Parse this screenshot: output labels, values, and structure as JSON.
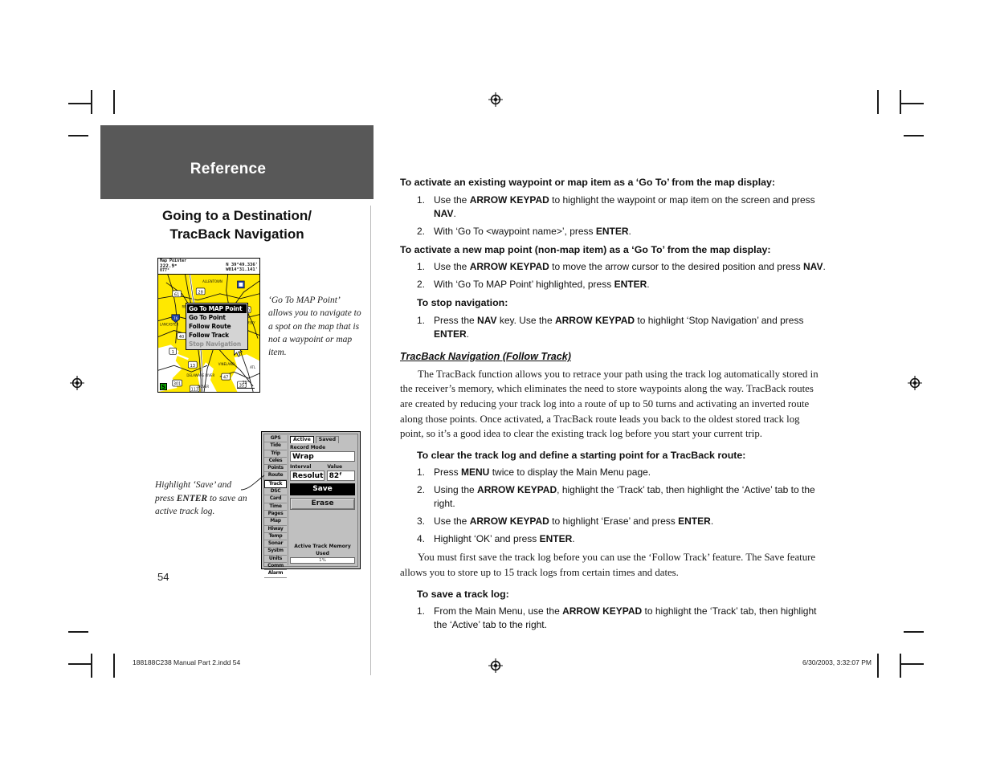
{
  "header": {
    "band_label": "Reference",
    "chapter_title_line1": "Going to a Destination/",
    "chapter_title_line2": "TracBack Navigation"
  },
  "page_number": "54",
  "figures": {
    "map_screen": {
      "header": {
        "title": "Map Pointer",
        "distance": "222.9ᵐ",
        "bearing": "077°",
        "lat": "N 39°49.336'",
        "lon": "W014°31.141'"
      },
      "menu_items": [
        {
          "label": "Go To MAP Point",
          "state": "selected"
        },
        {
          "label": "Go To Point",
          "state": "normal"
        },
        {
          "label": "Follow Route",
          "state": "normal"
        },
        {
          "label": "Follow Track",
          "state": "normal"
        },
        {
          "label": "Stop Navigation",
          "state": "disabled"
        }
      ],
      "scale": "12ᵐ",
      "satellite_indicator": "S",
      "caption": "‘Go To MAP Point’ allows you to navigate to a spot on the map that is not a waypoint or map item."
    },
    "track_screen": {
      "tabs": [
        "GPS",
        "Tide",
        "Trip",
        "Celes",
        "Points",
        "Route",
        "Track",
        "DSC",
        "Card",
        "Time",
        "Pages",
        "Map",
        "Hiway",
        "Temp",
        "Sonar",
        "Systm",
        "Units",
        "Comm",
        "Alarm"
      ],
      "active_tab": "Track",
      "subtabs": [
        "Active",
        "Saved"
      ],
      "active_subtab": "Active",
      "record_mode_label": "Record Mode",
      "record_mode_value": "Wrap",
      "interval_label": "Interval",
      "interval_value": "Resolution",
      "value_label": "Value",
      "value_value": "82ᶠ",
      "save_button": "Save",
      "erase_button": "Erase",
      "memory_label": "Active Track Memory Used",
      "memory_value": "1%",
      "caption_part1": "Highlight ‘Save’ and press ",
      "caption_bold": "ENTER",
      "caption_part2": " to save an active track log."
    }
  },
  "content": {
    "section1": {
      "heading": "To activate an existing waypoint or map item as a ‘Go To’ from the map display:",
      "steps": [
        {
          "num": "1.",
          "html": "Use the <b>ARROW KEYPAD</b> to highlight the waypoint or map item on the screen and press <b>NAV</b>."
        },
        {
          "num": "2.",
          "html": "With ‘Go To &lt;waypoint name&gt;’, press <b>ENTER</b>."
        }
      ]
    },
    "section2": {
      "heading": "To activate a new map point (non-map item) as a ‘Go To’ from the map display:",
      "steps": [
        {
          "num": "1.",
          "html": "Use the <b>ARROW KEYPAD</b> to move the arrow cursor to the desired position and press <b>NAV</b>."
        },
        {
          "num": "2.",
          "html": "With ‘Go To MAP Point’ highlighted, press <b>ENTER</b>."
        }
      ]
    },
    "section3": {
      "heading": "To stop navigation:",
      "steps": [
        {
          "num": "1.",
          "html": "Press the <b>NAV</b> key. Use the <b>ARROW KEYPAD</b> to highlight ‘Stop Navigation’ and press <b>ENTER</b>."
        }
      ]
    },
    "subsection_heading": "TracBack Navigation (Follow Track)",
    "paragraph1": "The TracBack function allows you to retrace your path using the track log automatically stored in the receiver’s memory, which eliminates the need to store waypoints along the way. TracBack routes are created by reducing your track log into a route of up to 50 turns and activating an inverted route along those points. Once activated, a TracBack route leads you back to the oldest stored track log point, so it’s a good idea to clear the existing track log before you start your current trip.",
    "section4": {
      "heading": "To clear the track log and define a starting point for a TracBack route:",
      "steps": [
        {
          "num": "1.",
          "html": "Press <b>MENU</b> twice to display the Main Menu page."
        },
        {
          "num": "2.",
          "html": "Using the <b>ARROW KEYPAD</b>, highlight the ‘Track’ tab, then highlight the ‘Active’ tab to the right."
        },
        {
          "num": "3.",
          "html": "Use the <b>ARROW KEYPAD</b> to highlight ‘Erase’ and press <b>ENTER</b>."
        },
        {
          "num": "4.",
          "html": "Highlight ‘OK’ and press <b>ENTER</b>."
        }
      ]
    },
    "paragraph2": "You must first save the track log before you can use the ‘Follow Track’ feature. The Save feature allows you to store up to 15 track logs from certain times and dates.",
    "section5": {
      "heading": "To save a track log:",
      "steps": [
        {
          "num": "1.",
          "html": "From the Main Menu, use the <b>ARROW KEYPAD</b> to highlight the ‘Track’ tab, then highlight the ‘Active’ tab to the right."
        }
      ]
    }
  },
  "footer": {
    "left": "188188C238 Manual Part 2.indd   54",
    "right": "6/30/2003, 3:32:07 PM"
  },
  "colors": {
    "band_gray": "#585858",
    "map_yellow": "#ffe800",
    "ui_gray": "#c0c0c0"
  }
}
